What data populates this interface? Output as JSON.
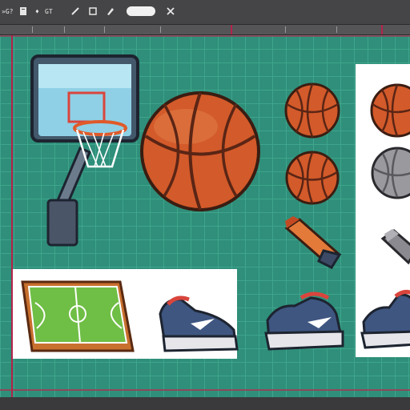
{
  "toolbar": {
    "items": [
      {
        "label": "»G?",
        "icon": "menu-icon"
      },
      {
        "label": "",
        "icon": "document-icon"
      },
      {
        "label": "♦",
        "icon": "layer-icon"
      },
      {
        "label": "GT",
        "icon": "text-icon"
      },
      {
        "label": "",
        "icon": "brush-icon"
      },
      {
        "label": "",
        "icon": "crop-icon"
      },
      {
        "label": "",
        "icon": "pen-icon"
      },
      {
        "label": "",
        "icon": "close-icon"
      }
    ],
    "search_value": ""
  },
  "colors": {
    "canvas": "#2f8f7a",
    "grid_minor": "#3fa58c",
    "grid_major": "#7fd1bc",
    "selection": "#b4234a",
    "panel": "#ffffff"
  },
  "assets": [
    {
      "name": "basketball-hoop"
    },
    {
      "name": "basketball-large"
    },
    {
      "name": "basketball-small-1"
    },
    {
      "name": "basketball-small-2"
    },
    {
      "name": "basketball-small-3"
    },
    {
      "name": "basketball-gray"
    },
    {
      "name": "marker-orange"
    },
    {
      "name": "marker-gray"
    },
    {
      "name": "basketball-court"
    },
    {
      "name": "sneaker-1"
    },
    {
      "name": "sneaker-2"
    },
    {
      "name": "sneaker-3"
    }
  ]
}
